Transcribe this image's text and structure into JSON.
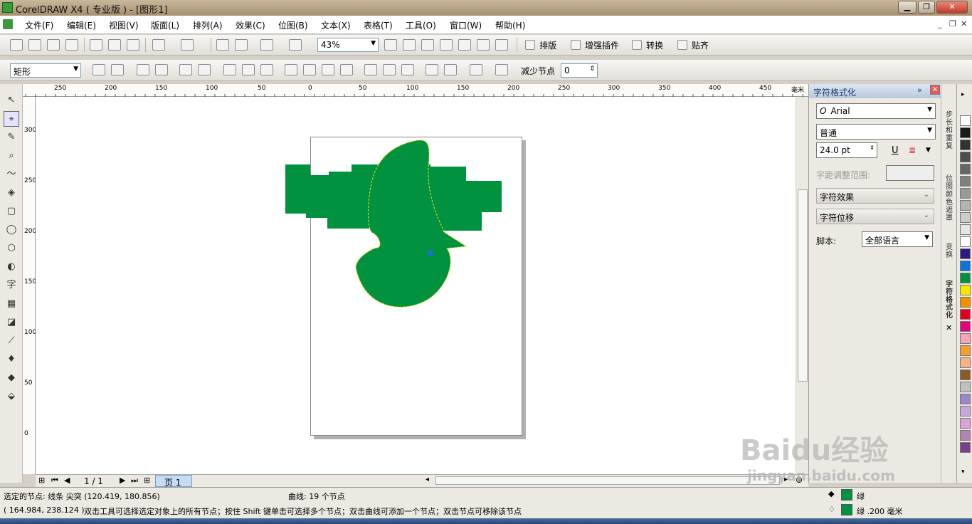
{
  "window": {
    "title": "CorelDRAW X4 ( 专业版 ) - [图形1]"
  },
  "menu": [
    "文件(F)",
    "编辑(E)",
    "视图(V)",
    "版面(L)",
    "排列(A)",
    "效果(C)",
    "位图(B)",
    "文本(X)",
    "表格(T)",
    "工具(O)",
    "窗口(W)",
    "帮助(H)"
  ],
  "toolbar": {
    "zoom_value": "43%",
    "text_buttons": [
      "排版",
      "增强插件",
      "转换",
      "贴齐"
    ]
  },
  "property_bar": {
    "shape_select": "矩形",
    "reduce_nodes_label": "减少节点",
    "reduce_nodes_value": "0"
  },
  "ruler": {
    "top_ticks": [
      "250",
      "200",
      "150",
      "100",
      "50",
      "0",
      "50",
      "100",
      "150",
      "200",
      "250",
      "300",
      "350",
      "400",
      "450"
    ],
    "top_unit": "毫米",
    "left_ticks": [
      "300",
      "250",
      "200",
      "150",
      "100",
      "50",
      "0"
    ]
  },
  "page_nav": {
    "counter": "1 / 1",
    "page_tab": "页 1"
  },
  "docker": {
    "title": "字符格式化",
    "font_name": "Arial",
    "font_style": "普通",
    "font_size": "24.0 pt",
    "kerning_label": "字距调整范围:",
    "char_effects": "字符效果",
    "char_shift": "字符位移",
    "script_label": "脚本:",
    "script_value": "全部语言"
  },
  "docker_tabs": [
    "步长和重复",
    "位图颜色遮罩",
    "变换",
    "字符格式化"
  ],
  "palette": [
    "#ffffff",
    "#1a1a1a",
    "#333333",
    "#4d4d4d",
    "#666666",
    "#808080",
    "#999999",
    "#b3b3b3",
    "#cccccc",
    "#e6e6e6",
    "#ffffff",
    "#2e1a87",
    "#0a74da",
    "#00923f",
    "#f7e600",
    "#f29100",
    "#e3001b",
    "#e5007e",
    "#f5a3b8",
    "#f0a030",
    "#f4b183",
    "#8b5a2b",
    "#c0c0c0",
    "#9b87c9",
    "#c8a8d8",
    "#dca0dc",
    "#b084b0",
    "#7a3e8c"
  ],
  "status": {
    "selected_nodes": "选定的节点: 线条 尖突 (120.419, 180.856)",
    "curve": "曲线:  19 个节点",
    "coords": "( 164.984, 238.124 )",
    "hint": "双击工具可选择选定对象上的所有节点；按住 Shift 键单击可选择多个节点；双击曲线可添加一个节点；双击节点可移除该节点",
    "fill_label": "绿",
    "outline_label": "绿  .200 毫米"
  },
  "shape_color": "#00923f",
  "watermark": {
    "main": "Baidu经验",
    "sub": "jingyan.baidu.com"
  }
}
